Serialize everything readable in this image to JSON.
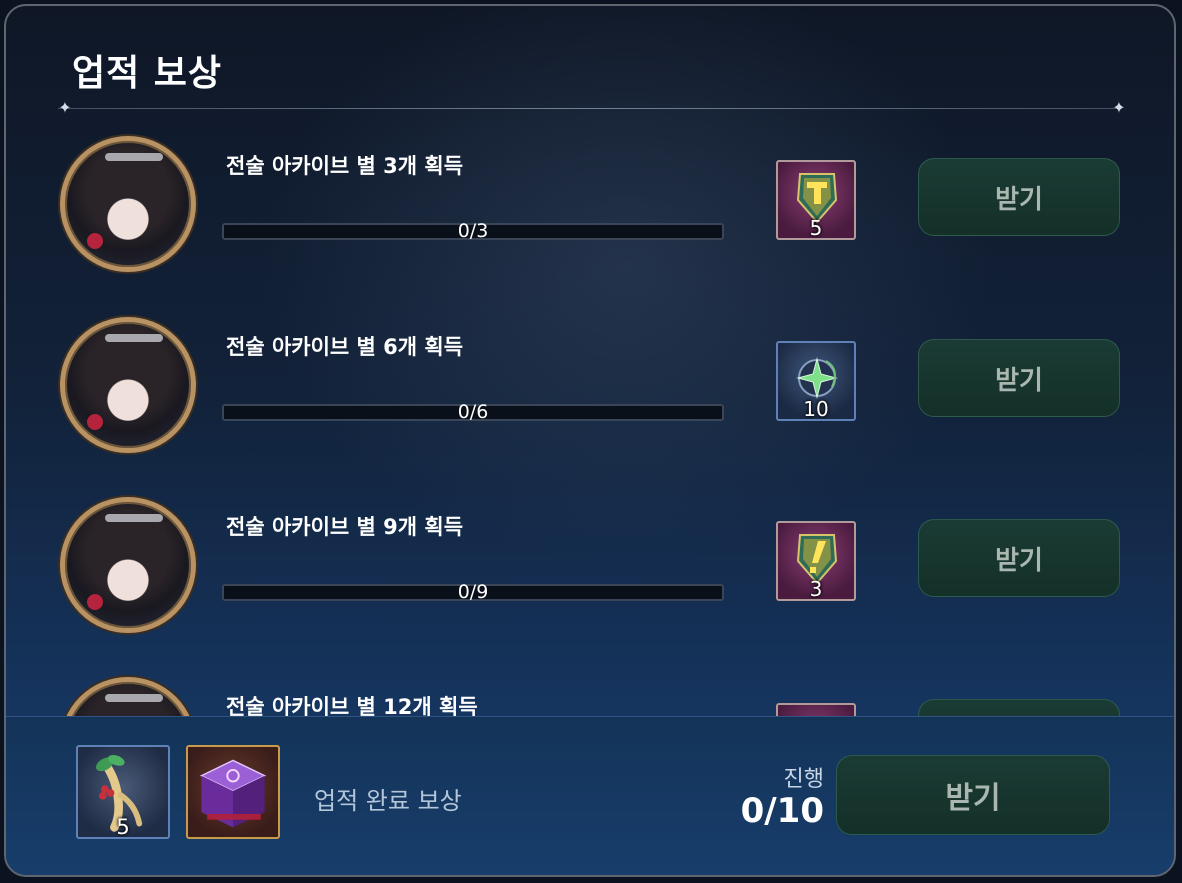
{
  "window": {
    "title": "업적 보상"
  },
  "achievements": [
    {
      "title": "전술 아카이브 별 3개 획득",
      "progress_text": "0/3",
      "progress": 0,
      "reward": {
        "icon": "gold-exclamation-stone-icon",
        "quantity": "5",
        "frame": "purple"
      },
      "claim_label": "받기"
    },
    {
      "title": "전술 아카이브 별 6개 획득",
      "progress_text": "0/6",
      "progress": 0,
      "reward": {
        "icon": "green-star-amulet-icon",
        "quantity": "10",
        "frame": "blue"
      },
      "claim_label": "받기"
    },
    {
      "title": "전술 아카이브 별 9개 획득",
      "progress_text": "0/9",
      "progress": 0,
      "reward": {
        "icon": "gold-exclamation-stone-icon",
        "quantity": "3",
        "frame": "purple"
      },
      "claim_label": "받기"
    },
    {
      "title": "전술 아카이브 별 12개 획득",
      "progress_text": "",
      "progress": 0,
      "reward": {
        "icon": "reward-item-icon",
        "quantity": "",
        "frame": "purple"
      },
      "claim_label": "받기"
    }
  ],
  "footer": {
    "rewards": [
      {
        "icon": "ginseng-root-icon",
        "quantity": "5"
      },
      {
        "icon": "purple-treasure-box-icon",
        "quantity": ""
      }
    ],
    "label": "업적 완료 보상",
    "progress_label": "진행",
    "progress_value": "0/10",
    "claim_label": "받기"
  },
  "colors": {
    "claim_bg": "#143028",
    "claim_text": "#a9b7b0",
    "avatar_ring": "#b89262"
  }
}
